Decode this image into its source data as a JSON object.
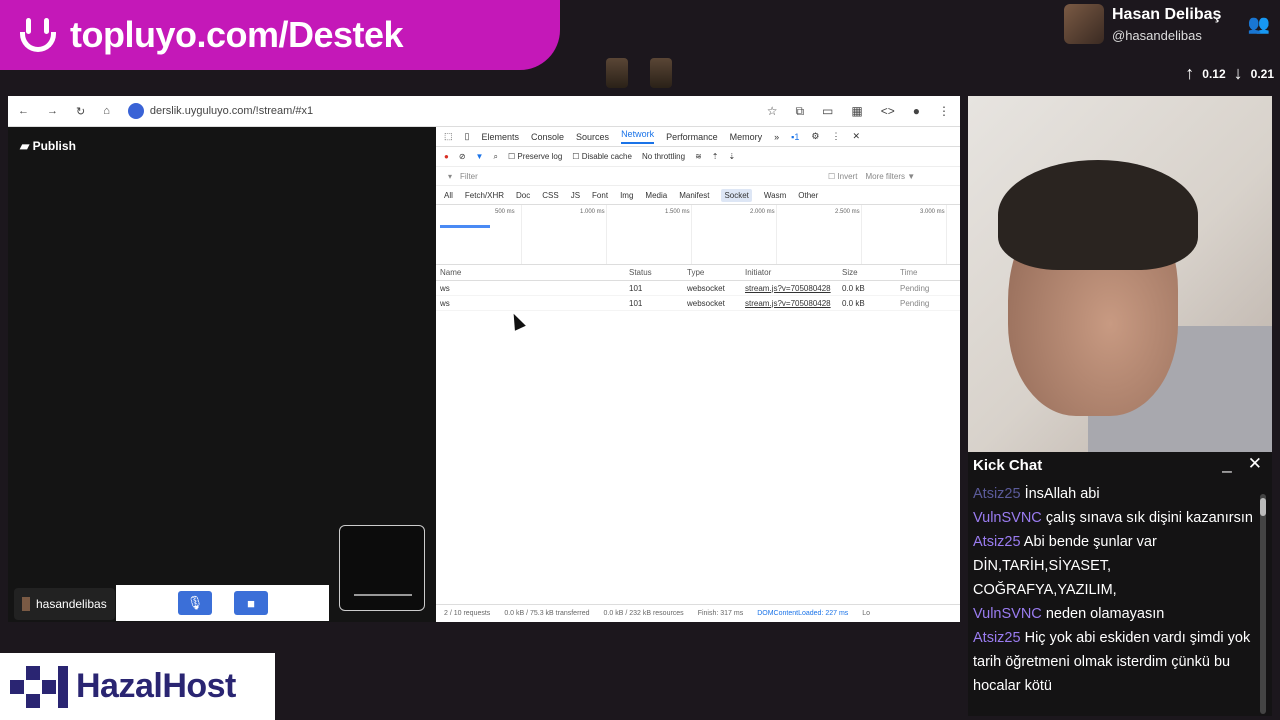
{
  "banner": {
    "text": "topluyo.com/Destek"
  },
  "profile": {
    "name": "Hasan Delibaş",
    "handle": "@hasandelibas",
    "up_value": "0.12",
    "down_value": "0.21"
  },
  "browser": {
    "url": "derslik.uyguluyo.com/!stream/#x1",
    "publish_label": "Publish",
    "user_tag": "hasandelibas"
  },
  "devtools": {
    "tabs": [
      "Elements",
      "Console",
      "Sources",
      "Network",
      "Performance",
      "Memory",
      "»"
    ],
    "active_tab": "Network",
    "issues_count": "1",
    "preserve_log": "Preserve log",
    "disable_cache": "Disable cache",
    "throttling": "No throttling",
    "filter_placeholder": "Filter",
    "invert": "Invert",
    "more_filters": "More filters ▼",
    "types": [
      "All",
      "Fetch/XHR",
      "Doc",
      "CSS",
      "JS",
      "Font",
      "Img",
      "Media",
      "Manifest",
      "Socket",
      "Wasm",
      "Other"
    ],
    "active_type": "Socket",
    "timeline_ticks": [
      "500 ms",
      "1.000 ms",
      "1.500 ms",
      "2.000 ms",
      "2.500 ms",
      "3.000 ms"
    ],
    "columns": [
      "Name",
      "Status",
      "Type",
      "Initiator",
      "Size",
      "Time"
    ],
    "rows": [
      {
        "name": "ws",
        "status": "101",
        "type": "websocket",
        "initiator": "stream.js?v=705080428",
        "size": "0.0 kB",
        "time": "Pending"
      },
      {
        "name": "ws",
        "status": "101",
        "type": "websocket",
        "initiator": "stream.js?v=705080428",
        "size": "0.0 kB",
        "time": "Pending"
      }
    ],
    "footer": {
      "requests": "2 / 10 requests",
      "transferred": "0.0 kB / 75.3 kB transferred",
      "resources": "0.0 kB / 232 kB resources",
      "finish": "Finish: 317 ms",
      "dcl": "DOMContentLoaded: 227 ms",
      "load": "Lo"
    }
  },
  "chat": {
    "title": "Kick Chat",
    "messages": [
      {
        "user": "Atsiz25",
        "text": "İnsAllah abi",
        "faded": true
      },
      {
        "user": "VulnSVNC",
        "text": "çalış sınava sık dişini kazanırsın"
      },
      {
        "user": "Atsiz25",
        "text": "Abi bende şunlar var DİN,TARİH,SİYASET, COĞRAFYA,YAZILIM,"
      },
      {
        "user": "VulnSVNC",
        "text": "neden olamayasın"
      },
      {
        "user": "Atsiz25",
        "text": "Hiç yok abi eskiden vardı şimdi yok tarih öğretmeni olmak isterdim çünkü bu hocalar kötü"
      }
    ]
  },
  "logo": {
    "text": "HazalHost"
  },
  "colors": {
    "banner": "#c418b8",
    "accent": "#1a73e8",
    "chat_user": "#9a7cf0"
  }
}
